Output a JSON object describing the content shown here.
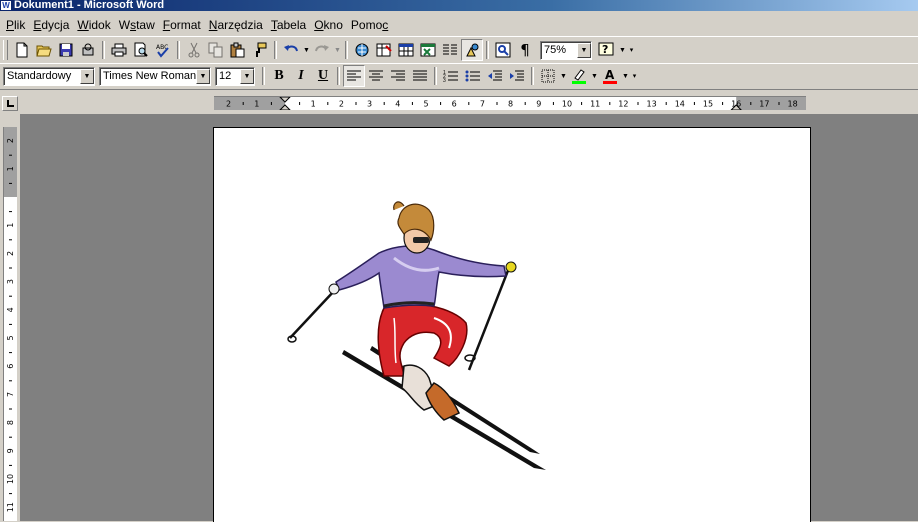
{
  "window": {
    "title": "Dokument1 - Microsoft Word",
    "app_icon": "W"
  },
  "menu": [
    {
      "label": "Plik",
      "hot": "P"
    },
    {
      "label": "Edycja",
      "hot": "E"
    },
    {
      "label": "Widok",
      "hot": "W"
    },
    {
      "label": "Wstaw",
      "hot": "s"
    },
    {
      "label": "Format",
      "hot": "F"
    },
    {
      "label": "Narzędzia",
      "hot": "N"
    },
    {
      "label": "Tabela",
      "hot": "T"
    },
    {
      "label": "Okno",
      "hot": "O"
    },
    {
      "label": "Pomoc",
      "hot": "c"
    }
  ],
  "standard_toolbar": {
    "zoom": "75%"
  },
  "formatting_toolbar": {
    "style": "Standardowy",
    "font": "Times New Roman",
    "size": "12",
    "bold": "B",
    "italic": "I",
    "underline": "U"
  },
  "ruler": {
    "h_labels": [
      "2",
      "1",
      "1",
      "2",
      "3",
      "4",
      "5",
      "6",
      "7",
      "8",
      "9",
      "10",
      "11",
      "12",
      "13",
      "14",
      "15",
      "16",
      "17",
      "18"
    ],
    "v_labels": [
      "2",
      "1",
      "1",
      "2",
      "3",
      "4",
      "5",
      "6",
      "7",
      "8",
      "9",
      "10",
      "11"
    ]
  },
  "colors": {
    "title_start": "#0a246a",
    "title_end": "#a6caf0",
    "face": "#d4d0c8",
    "workspace": "#808080",
    "highlight": "#00ff00",
    "font_color": "#ff0000"
  },
  "document": {
    "clipart": "skier-clipart"
  }
}
